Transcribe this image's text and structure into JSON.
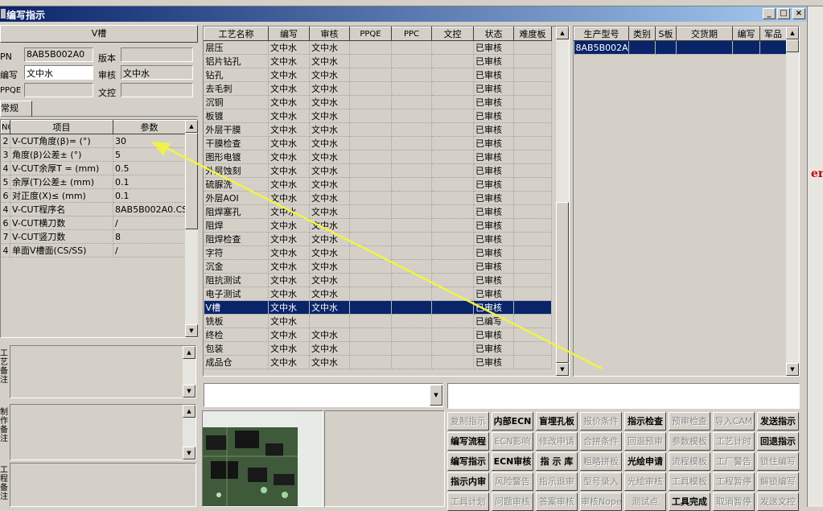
{
  "window": {
    "title": "编写指示"
  },
  "left": {
    "header": "V槽",
    "fields": [
      {
        "label": "PN",
        "value": "8AB5B002A0"
      },
      {
        "label": "版本",
        "value": ""
      },
      {
        "label": "编写",
        "value": "文中水"
      },
      {
        "label": "审核",
        "value": "文中水"
      },
      {
        "label": "PPQE",
        "value": ""
      },
      {
        "label": "文控",
        "value": ""
      }
    ],
    "tab": "常规",
    "param_headers": [
      "NO",
      "项目",
      "参数"
    ],
    "params": [
      {
        "no": "2",
        "item": "V-CUT角度(β)=  (°)",
        "value": "30"
      },
      {
        "no": "3",
        "item": "角度(β)公差±  (°)",
        "value": "5"
      },
      {
        "no": "4",
        "item": "V-CUT余厚T =  (mm)",
        "value": "0.5"
      },
      {
        "no": "5",
        "item": "余厚(T)公差±  (mm)",
        "value": "0.1"
      },
      {
        "no": "6",
        "item": "对正度(X)≤  (mm)",
        "value": "0.1"
      },
      {
        "no": "4",
        "item": "V-CUT程序名",
        "value": "8AB5B002A0.CSV"
      },
      {
        "no": "6",
        "item": "V-CUT横刀数",
        "value": "/"
      },
      {
        "no": "7",
        "item": "V-CUT竖刀数",
        "value": "8"
      },
      {
        "no": "4",
        "item": "单面V槽面(CS/SS)",
        "value": "/"
      }
    ],
    "note_labels": [
      "工艺备注",
      "制作备注",
      "工程备注"
    ]
  },
  "process": {
    "headers": [
      "工艺名称",
      "编写",
      "审核",
      "PPQE",
      "PPC",
      "文控",
      "状态",
      "难度板"
    ],
    "rows": [
      {
        "name": "层压",
        "writer": "文中水",
        "reviewer": "文中水",
        "ppqe": "",
        "ppc": "",
        "dc": "",
        "status": "已审核",
        "diff": ""
      },
      {
        "name": "铝片钻孔",
        "writer": "文中水",
        "reviewer": "文中水",
        "ppqe": "",
        "ppc": "",
        "dc": "",
        "status": "已审核",
        "diff": ""
      },
      {
        "name": "钻孔",
        "writer": "文中水",
        "reviewer": "文中水",
        "ppqe": "",
        "ppc": "",
        "dc": "",
        "status": "已审核",
        "diff": ""
      },
      {
        "name": "去毛刺",
        "writer": "文中水",
        "reviewer": "文中水",
        "ppqe": "",
        "ppc": "",
        "dc": "",
        "status": "已审核",
        "diff": ""
      },
      {
        "name": "沉铜",
        "writer": "文中水",
        "reviewer": "文中水",
        "ppqe": "",
        "ppc": "",
        "dc": "",
        "status": "已审核",
        "diff": ""
      },
      {
        "name": "板镀",
        "writer": "文中水",
        "reviewer": "文中水",
        "ppqe": "",
        "ppc": "",
        "dc": "",
        "status": "已审核",
        "diff": ""
      },
      {
        "name": "外层干膜",
        "writer": "文中水",
        "reviewer": "文中水",
        "ppqe": "",
        "ppc": "",
        "dc": "",
        "status": "已审核",
        "diff": ""
      },
      {
        "name": "干膜检查",
        "writer": "文中水",
        "reviewer": "文中水",
        "ppqe": "",
        "ppc": "",
        "dc": "",
        "status": "已审核",
        "diff": ""
      },
      {
        "name": "图形电镀",
        "writer": "文中水",
        "reviewer": "文中水",
        "ppqe": "",
        "ppc": "",
        "dc": "",
        "status": "已审核",
        "diff": ""
      },
      {
        "name": "外层蚀刻",
        "writer": "文中水",
        "reviewer": "文中水",
        "ppqe": "",
        "ppc": "",
        "dc": "",
        "status": "已审核",
        "diff": ""
      },
      {
        "name": "硫脲洗",
        "writer": "文中水",
        "reviewer": "文中水",
        "ppqe": "",
        "ppc": "",
        "dc": "",
        "status": "已审核",
        "diff": ""
      },
      {
        "name": "外层AOI",
        "writer": "文中水",
        "reviewer": "文中水",
        "ppqe": "",
        "ppc": "",
        "dc": "",
        "status": "已审核",
        "diff": ""
      },
      {
        "name": "阻焊塞孔",
        "writer": "文中水",
        "reviewer": "文中水",
        "ppqe": "",
        "ppc": "",
        "dc": "",
        "status": "已审核",
        "diff": ""
      },
      {
        "name": "阻焊",
        "writer": "文中水",
        "reviewer": "文中水",
        "ppqe": "",
        "ppc": "",
        "dc": "",
        "status": "已审核",
        "diff": ""
      },
      {
        "name": "阻焊检查",
        "writer": "文中水",
        "reviewer": "文中水",
        "ppqe": "",
        "ppc": "",
        "dc": "",
        "status": "已审核",
        "diff": ""
      },
      {
        "name": "字符",
        "writer": "文中水",
        "reviewer": "文中水",
        "ppqe": "",
        "ppc": "",
        "dc": "",
        "status": "已审核",
        "diff": ""
      },
      {
        "name": "沉金",
        "writer": "文中水",
        "reviewer": "文中水",
        "ppqe": "",
        "ppc": "",
        "dc": "",
        "status": "已审核",
        "diff": ""
      },
      {
        "name": "阻抗测试",
        "writer": "文中水",
        "reviewer": "文中水",
        "ppqe": "",
        "ppc": "",
        "dc": "",
        "status": "已审核",
        "diff": ""
      },
      {
        "name": "电子测试",
        "writer": "文中水",
        "reviewer": "文中水",
        "ppqe": "",
        "ppc": "",
        "dc": "",
        "status": "已审核",
        "diff": ""
      },
      {
        "name": "V槽",
        "writer": "文中水",
        "reviewer": "文中水",
        "ppqe": "",
        "ppc": "",
        "dc": "",
        "status": "已审核",
        "diff": "",
        "selected": true
      },
      {
        "name": "铣板",
        "writer": "文中水",
        "reviewer": "",
        "ppqe": "",
        "ppc": "",
        "dc": "",
        "status": "已编写",
        "diff": ""
      },
      {
        "name": "终检",
        "writer": "文中水",
        "reviewer": "文中水",
        "ppqe": "",
        "ppc": "",
        "dc": "",
        "status": "已审核",
        "diff": ""
      },
      {
        "name": "包装",
        "writer": "文中水",
        "reviewer": "文中水",
        "ppqe": "",
        "ppc": "",
        "dc": "",
        "status": "已审核",
        "diff": ""
      },
      {
        "name": "成品仓",
        "writer": "文中水",
        "reviewer": "文中水",
        "ppqe": "",
        "ppc": "",
        "dc": "",
        "status": "已审核",
        "diff": ""
      }
    ]
  },
  "orders": {
    "headers": [
      "生产型号",
      "类别",
      "S板",
      "交货期",
      "编写",
      "军品"
    ],
    "rows": [
      {
        "model": "8AB5B002A0",
        "cat": "",
        "s": "",
        "due": "",
        "writer": "",
        "mil": ""
      }
    ]
  },
  "buttons": [
    [
      {
        "label": "复制指示",
        "enabled": false
      },
      {
        "label": "内部ECN",
        "enabled": true
      },
      {
        "label": "盲埋孔板",
        "enabled": true
      },
      {
        "label": "报价条件",
        "enabled": false
      },
      {
        "label": "指示检查",
        "enabled": true
      },
      {
        "label": "预审检查",
        "enabled": false
      },
      {
        "label": "导入CAM",
        "enabled": false
      },
      {
        "label": "发送指示",
        "enabled": true
      }
    ],
    [
      {
        "label": "编写流程",
        "enabled": true
      },
      {
        "label": "ECN影响",
        "enabled": false
      },
      {
        "label": "修改申请",
        "enabled": false
      },
      {
        "label": "合拼条件",
        "enabled": false
      },
      {
        "label": "回退预审",
        "enabled": false
      },
      {
        "label": "参数模板",
        "enabled": false
      },
      {
        "label": "工艺计时",
        "enabled": false
      },
      {
        "label": "回退指示",
        "enabled": true
      }
    ],
    [
      {
        "label": "编写指示",
        "enabled": true
      },
      {
        "label": "ECN审核",
        "enabled": true
      },
      {
        "label": "指 示 库",
        "enabled": true
      },
      {
        "label": "粗略拼板",
        "enabled": false
      },
      {
        "label": "光绘申请",
        "enabled": true
      },
      {
        "label": "流程模板",
        "enabled": false
      },
      {
        "label": "工厂警告",
        "enabled": false
      },
      {
        "label": "锁住编写",
        "enabled": false
      }
    ],
    [
      {
        "label": "指示内审",
        "enabled": true
      },
      {
        "label": "风险警告",
        "enabled": false
      },
      {
        "label": "指示退审",
        "enabled": false
      },
      {
        "label": "型号录入",
        "enabled": false
      },
      {
        "label": "光绘审核",
        "enabled": false
      },
      {
        "label": "工具模板",
        "enabled": false
      },
      {
        "label": "工程暂停",
        "enabled": false
      },
      {
        "label": "解锁编写",
        "enabled": false
      }
    ],
    [
      {
        "label": "工具计划",
        "enabled": false
      },
      {
        "label": "问题审核",
        "enabled": false
      },
      {
        "label": "答案审核",
        "enabled": false
      },
      {
        "label": "审核Nope",
        "enabled": false
      },
      {
        "label": "测试点",
        "enabled": false
      },
      {
        "label": "工具完成",
        "enabled": true
      },
      {
        "label": "取消暂停",
        "enabled": false
      },
      {
        "label": "发送文控",
        "enabled": false
      }
    ]
  ],
  "annotation": {
    "color": "#f2f24a"
  },
  "edge_text": "er"
}
